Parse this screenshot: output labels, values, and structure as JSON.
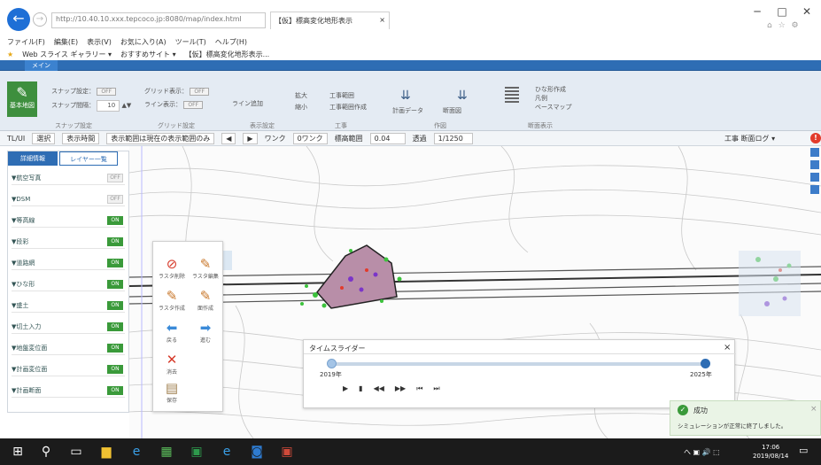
{
  "browser": {
    "url": "http://10.40.10.xxx.tepcoco.jp:8080/map/index.html",
    "tab_title": "【仮】標高変化地形表示",
    "tab_close": "×",
    "back_icon": "back-arrow-icon",
    "win_min": "─",
    "win_max": "□",
    "win_close": "✕",
    "toolbar_icons": "⌂ ☆ ⚙"
  },
  "menubar": [
    "ファイル(F)",
    "編集(E)",
    "表示(V)",
    "お気に入り(A)",
    "ツール(T)",
    "ヘルプ(H)"
  ],
  "favbar": [
    "Web スライス ギャラリー ▾",
    "おすすめサイト ▾",
    "【仮】標高変化地形表示..."
  ],
  "app_tab": "メイン",
  "ribbon": {
    "big_button": "基本地図",
    "row1": [
      {
        "label": "スナップ設定：",
        "value": "OFF"
      },
      {
        "label": "グリッド表示：",
        "value": "OFF"
      },
      {
        "label": "ライン表示：",
        "value": "OFF"
      }
    ],
    "snap_label": "スナップ間隔：",
    "snap_value": "10",
    "items": [
      "ライン追加",
      "拡大",
      "縮小",
      "工事範囲",
      "工事範囲作成",
      "計画データ",
      "断面図"
    ],
    "right_items": [
      "ひな形作成",
      "凡例",
      "ベースマップ"
    ],
    "groups": [
      "スナップ設定",
      "グリッド設定",
      "表示設定",
      "工事",
      "作図",
      "断面表示"
    ]
  },
  "toolbar2": {
    "label1": "TL/UI",
    "box1": "選択",
    "box2": "表示時間",
    "box3": "表示範囲は現在の表示範囲のみ",
    "nav": [
      "◀",
      "▶"
    ],
    "label2": "ワンク",
    "box4": "0ワンク",
    "label3": "標高範囲",
    "box5": "0.04",
    "label4": "透過",
    "box6": "1/1250",
    "right": "工事 断面ログ ▾",
    "alert": "!"
  },
  "panel": {
    "tab1": "詳細情報",
    "tab2": "レイヤー一覧",
    "layers": [
      {
        "name": "▼航空写真",
        "state": "OFF"
      },
      {
        "name": "▼DSM",
        "state": "OFF"
      },
      {
        "name": "▼等高線",
        "state": "ON"
      },
      {
        "name": "▼段彩",
        "state": "ON"
      },
      {
        "name": "▼道路網",
        "state": "ON"
      },
      {
        "name": "▼ひな形",
        "state": "ON"
      },
      {
        "name": "▼盛土",
        "state": "ON"
      },
      {
        "name": "▼切土入力",
        "state": "ON"
      },
      {
        "name": "▼地盤変位面",
        "state": "ON"
      },
      {
        "name": "▼計画変位面",
        "state": "ON"
      },
      {
        "name": "▼計画断面",
        "state": "ON"
      }
    ]
  },
  "tools": [
    {
      "icon": "⊘",
      "label": "ラスタ削除"
    },
    {
      "icon": "✎",
      "label": "ラスタ編集"
    },
    {
      "icon": "✎",
      "label": "ラスタ作成"
    },
    {
      "icon": "✎",
      "label": "面作成"
    },
    {
      "icon": "⬅",
      "label": "戻る"
    },
    {
      "icon": "➡",
      "label": "進む"
    },
    {
      "icon": "✕",
      "label": "消去"
    },
    {
      "icon": "▤",
      "label": "保存"
    }
  ],
  "slider": {
    "title": "タイムスライダー",
    "close": "×",
    "start": "2019年",
    "end": "2025年",
    "controls": [
      "▶",
      "▮",
      "◀◀",
      "▶▶",
      "⏮",
      "⏭"
    ]
  },
  "toast": {
    "title": "成功",
    "message": "シミュレーションが正常に終了しました。",
    "close": "×"
  },
  "taskbar": {
    "icons": [
      "windows-icon",
      "search-icon",
      "task-view-icon",
      "explorer-icon",
      "ie-icon",
      "store-icon",
      "excel-icon",
      "ie2-icon",
      "outlook-icon",
      "app-icon"
    ],
    "tray": "へ ▣ 🔊 ⬚",
    "time": "17:06",
    "date": "2019/08/14"
  },
  "colors": {
    "accent": "#2e6db4",
    "ribbon": "#e4ebf3",
    "switch_on": "#3a9a3a",
    "alert": "#e23b2c"
  }
}
